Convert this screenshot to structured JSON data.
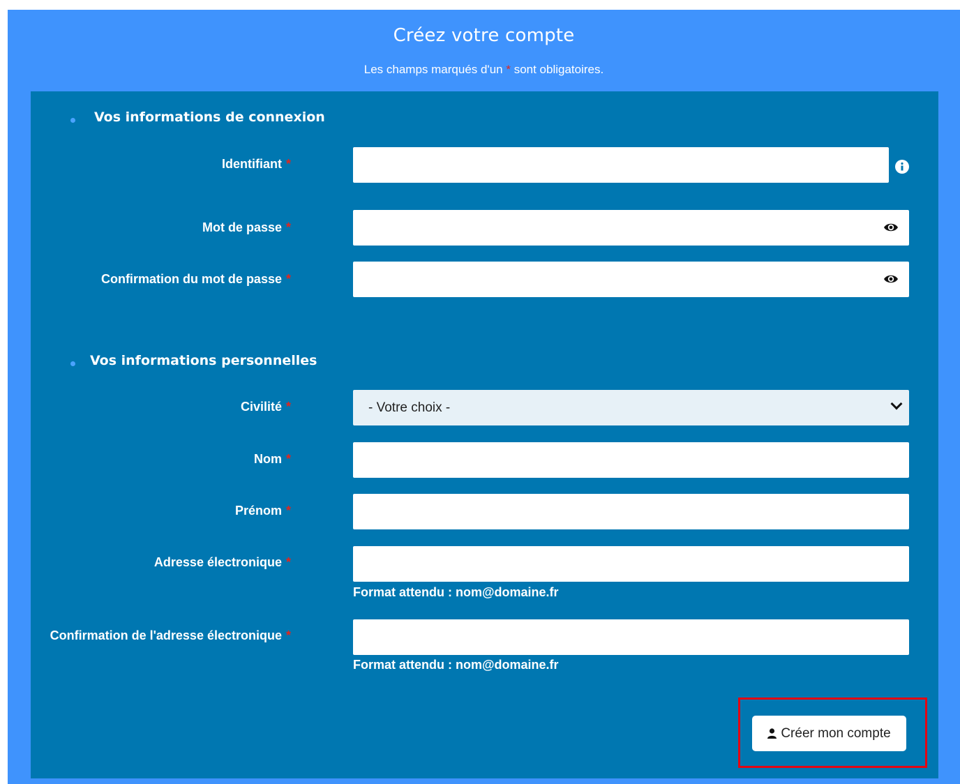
{
  "header": {
    "title": "Créez votre compte",
    "subtitle_before": "Les champs marqués d'un",
    "subtitle_star": "*",
    "subtitle_after": "sont obligatoires."
  },
  "sections": {
    "login": {
      "title": "Vos informations de connexion",
      "fields": {
        "identifiant": {
          "label": "Identifiant",
          "value": ""
        },
        "password": {
          "label": "Mot de passe",
          "value": ""
        },
        "password_confirm": {
          "label": "Confirmation du mot de passe",
          "value": ""
        }
      }
    },
    "personal": {
      "title": "Vos informations personnelles",
      "fields": {
        "civilite": {
          "label": "Civilité",
          "selected": "- Votre choix -"
        },
        "nom": {
          "label": "Nom",
          "value": ""
        },
        "prenom": {
          "label": "Prénom",
          "value": ""
        },
        "email": {
          "label": "Adresse électronique",
          "value": "",
          "hint": "Format attendu : nom@domaine.fr"
        },
        "email_confirm": {
          "label": "Confirmation de l'adresse électronique",
          "value": "",
          "hint": "Format attendu : nom@domaine.fr"
        }
      }
    }
  },
  "required_marker": "*",
  "submit": {
    "label": "Créer mon compte",
    "icon": "user-icon"
  },
  "icons": {
    "info": "info-icon",
    "eye": "eye-icon",
    "chevron": "chevron-down-icon"
  },
  "colors": {
    "outer_bg": "#3f93fd",
    "panel_bg": "#0077b1",
    "required": "#e0271f",
    "highlight": "#e30613"
  }
}
